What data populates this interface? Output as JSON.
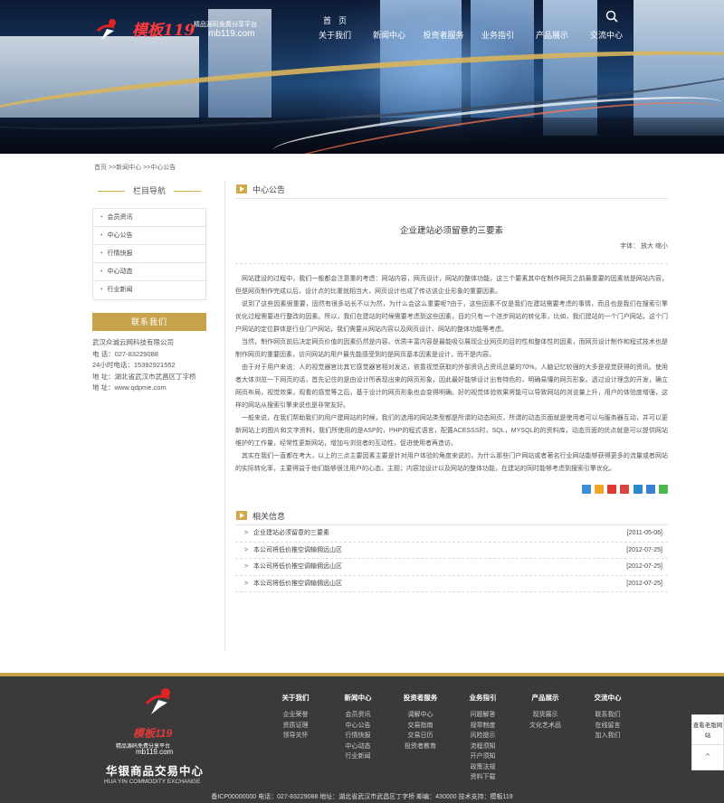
{
  "brand": {
    "logo_text": "模板119",
    "tagline": "精品源码免费分享平台",
    "domain": "mb119.com"
  },
  "nav": [
    {
      "zh": "首页",
      "en": "关于我们"
    },
    {
      "zh": "",
      "en": "新闻中心"
    },
    {
      "zh": "",
      "en": "投资者服务"
    },
    {
      "zh": "",
      "en": "业务指引"
    },
    {
      "zh": "",
      "en": "产品展示"
    },
    {
      "zh": "",
      "en": "交流中心"
    }
  ],
  "breadcrumb": "首页 >>新闻中心 >>中心公告",
  "sidebar": {
    "title": "栏目导航",
    "items": [
      "会员资讯",
      "中心公告",
      "行情快报",
      "中心动态",
      "行业新闻"
    ],
    "contact_title": "联系我们",
    "contact": [
      "武汉众诚云网科技有限公司",
      "电  话：027-83229088",
      "24小时电话：15392921552",
      "地  址：湖北省武汉市武昌区丁字桥",
      "地  址：www.qdpme.com"
    ]
  },
  "main": {
    "section_title": "中心公告",
    "article_title": "企业建站必须留意的三要素",
    "font_label": "字体：",
    "font_large": "放大",
    "font_small": "缩小",
    "paragraphs": [
      "网站建设的过程中，我们一般都会注意重的考虑：网站内容，网页设计，网站的整体功能，这三个要素其中在制作网页之前最重要的因素就是网站内容，但是网页制作完成以后，设计点的比重就相当大，网页设计也成了传达该企业形象的重要因素。",
      "说到了这些因素很重要，固然有很多站长不以为然，为什么会这么重要呢?由于，这些因素不仅是我们在建站需要考虑的事情，而且也是我们在搜索引擎优化过程需要进行整改的因素。所以，我们在建站的时候需要考虑到这些因素，目的只有一个进步网站的转化率，比如，我们建站的一个门户网站，这个门户网站的定位群体是行业门户网站，我们需要从网站内容以及网页设计、网站的整体功能等考虑。",
      "当然，制作网页前后决定网页价值的因素仍然是内容。优质丰富内容是最能吸引展现企业网页的目的性和整体性的因素，而网页设计制作和程式技术也是制作网页的重要因素，访问网站的用户最先能感受到的是网页基本因素是设计，而不是内容。",
      "由于对于用户来说：人的视觉器官比其它感觉器官相对发达，依靠视觉获取的外部资讯占资讯总量的70%。人脑记忆较强的大多是视觉获得的资讯。使用者大体浏览一下网页的话，首先记住的是由设计所表现出来的网页形象，因此最好能够设计出有特色的，明确易懂的网页形象。透过设计理念的开发，确立网页布局，视觉效果，观看的感觉等之后，基于设计的网页形象也会变得明确。好的视觉体验效果将能可以导致网站的浏览量上升，用户的体验度增强，这样的网站从搜索引擎来说也是非常友好。",
      "一般来说，在我们帮助我们的用户建网站的时候，我们的选用的网站类型都是所谓的动态网页，所谓的动态页面就是使用者可以与服务器互动，并可以更新网站上的图片和文字资料，我们所使用的是ASP的，PHP的程式语言，配置ACESSS时，SQL，MYSQL的的资料库，动态页面的优点就是可以提供网站维护的工作量，经常性更新网站，增加与浏览者的互动性，促进使用者再造访。",
      "其实在我们一直都在考大，以上的三点主要因素主要是针对用户体验的角度来说的，为什么那些门户网站或者著名行业网站能够获得更多的流量或者网站的实际转化率，主要得益于他们能够很注用户的心态，主题；内容加设计以及网站的整体功能，在建站的同时能够考虑到搜索引擎优化。"
    ],
    "related_title": "相关信息",
    "related": [
      {
        "title": "企业建站必须留意的三要素",
        "date": "[2011-05-06]"
      },
      {
        "title": "本公司将低价推空调输佣远山区",
        "date": "[2012-07-25]"
      },
      {
        "title": "本公司将低价推空调输佣远山区",
        "date": "[2012-07-25]"
      },
      {
        "title": "本公司将低价推空调输佣远山区",
        "date": "[2012-07-25]"
      }
    ]
  },
  "footer": {
    "logo_text": "模板119",
    "tagline": "精品源码免费分享平台",
    "domain": "mb119.com",
    "company_zh": "华银商品交易中心",
    "company_en": "HUA YIN COMMODITY EXCHANGE",
    "columns": [
      {
        "head": "关于我们",
        "links": [
          "企业荣誉",
          "资质证理",
          "领导关怀"
        ]
      },
      {
        "head": "新闻中心",
        "links": [
          "会员资讯",
          "中心公告",
          "行情快报",
          "中心动态",
          "行业新闻"
        ]
      },
      {
        "head": "投资者服务",
        "links": [
          "调解中心",
          "交易指南",
          "交易日历",
          "投资者教育"
        ]
      },
      {
        "head": "业务指引",
        "links": [
          "问题解答",
          "规章制度",
          "风险提示",
          "流程须知",
          "开户须知",
          "政策法规",
          "资料下载"
        ]
      },
      {
        "head": "产品展示",
        "links": [
          "现货展示",
          "文化艺术品"
        ]
      },
      {
        "head": "交流中心",
        "links": [
          "联系我们",
          "在线留言",
          "加入我们"
        ]
      }
    ],
    "bottom": "备ICP00000000 电话：027-83229088      地址：湖北省武汉市武昌区丁字桥      邮编：430000      技术支持：模板119"
  },
  "float": {
    "label": "查看老版网站",
    "top": "⌃"
  },
  "colors": {
    "accent": "#c9a34c",
    "footer_bg": "#3a3a3a"
  }
}
